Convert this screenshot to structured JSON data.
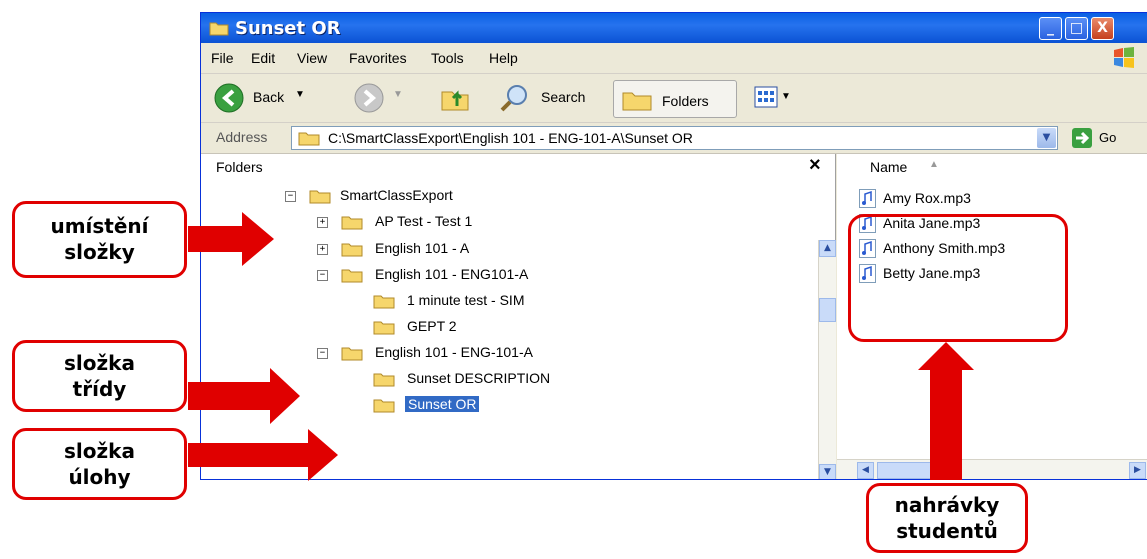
{
  "window": {
    "title": "Sunset OR",
    "controls": {
      "minimize": "_",
      "maximize": "□",
      "close": "X"
    }
  },
  "menubar": {
    "items": [
      "File",
      "Edit",
      "View",
      "Favorites",
      "Tools",
      "Help"
    ]
  },
  "toolbar": {
    "back_label": "Back",
    "search_label": "Search",
    "folders_label": "Folders"
  },
  "addressbar": {
    "label": "Address",
    "path": "C:\\SmartClassExport\\English 101 - ENG-101-A\\Sunset OR",
    "go_label": "Go"
  },
  "folders_pane": {
    "header": "Folders",
    "close_glyph": "×",
    "tree": [
      {
        "label": "SmartClassExport",
        "expander": "−"
      },
      {
        "label": "AP Test - Test 1",
        "expander": "+"
      },
      {
        "label": "English 101 - A",
        "expander": "+"
      },
      {
        "label": "English 101 - ENG101-A",
        "expander": "−"
      },
      {
        "label": "1 minute test - SIM",
        "expander": ""
      },
      {
        "label": "GEPT 2",
        "expander": ""
      },
      {
        "label": "English 101 - ENG-101-A",
        "expander": "−"
      },
      {
        "label": "Sunset DESCRIPTION",
        "expander": ""
      },
      {
        "label": "Sunset OR",
        "expander": "",
        "selected": true
      }
    ]
  },
  "files_pane": {
    "column_header": "Name",
    "files": [
      "Amy Rox.mp3",
      "Anita Jane.mp3",
      "Anthony Smith.mp3",
      "Betty Jane.mp3"
    ]
  },
  "callouts": {
    "location": [
      "umístění",
      "složky"
    ],
    "class_folder": [
      "složka",
      "třídy"
    ],
    "assignment_folder": [
      "složka",
      "úlohy"
    ],
    "recordings": [
      "nahrávky",
      "studentů"
    ]
  },
  "colors": {
    "accent_red": "#e00000",
    "titlebar_blue": "#0b52d4",
    "selection_blue": "#316ac5"
  }
}
